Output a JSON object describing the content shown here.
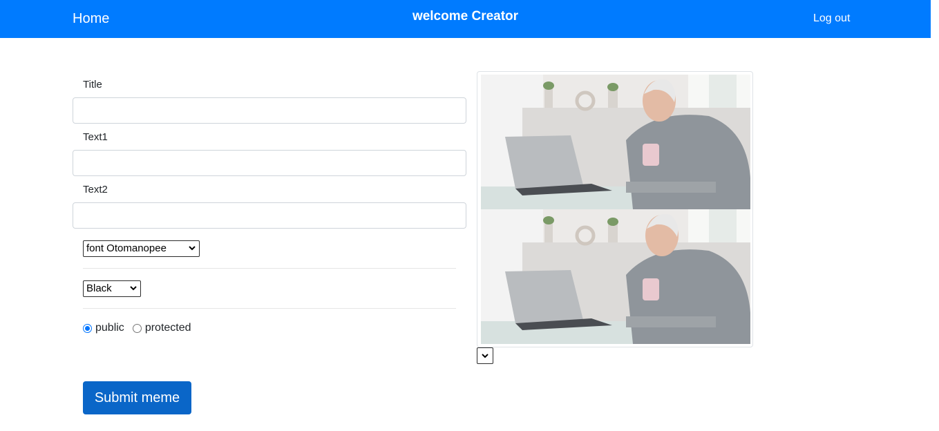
{
  "header": {
    "home_label": "Home",
    "welcome_text": "welcome Creator",
    "logout_label": "Log out",
    "bg_color": "#007bff"
  },
  "form": {
    "title_label": "Title",
    "title_value": "",
    "text1_label": "Text1",
    "text1_value": "",
    "text2_label": "Text2",
    "text2_value": "",
    "font_select": {
      "selected": "font Otomanopee"
    },
    "color_select": {
      "selected": "Black"
    },
    "visibility": {
      "options": [
        "public",
        "protected"
      ],
      "selected": "public"
    },
    "submit_label": "Submit meme"
  },
  "preview": {
    "image_name": "meme-template-image",
    "template_select": {
      "selected": ""
    }
  }
}
